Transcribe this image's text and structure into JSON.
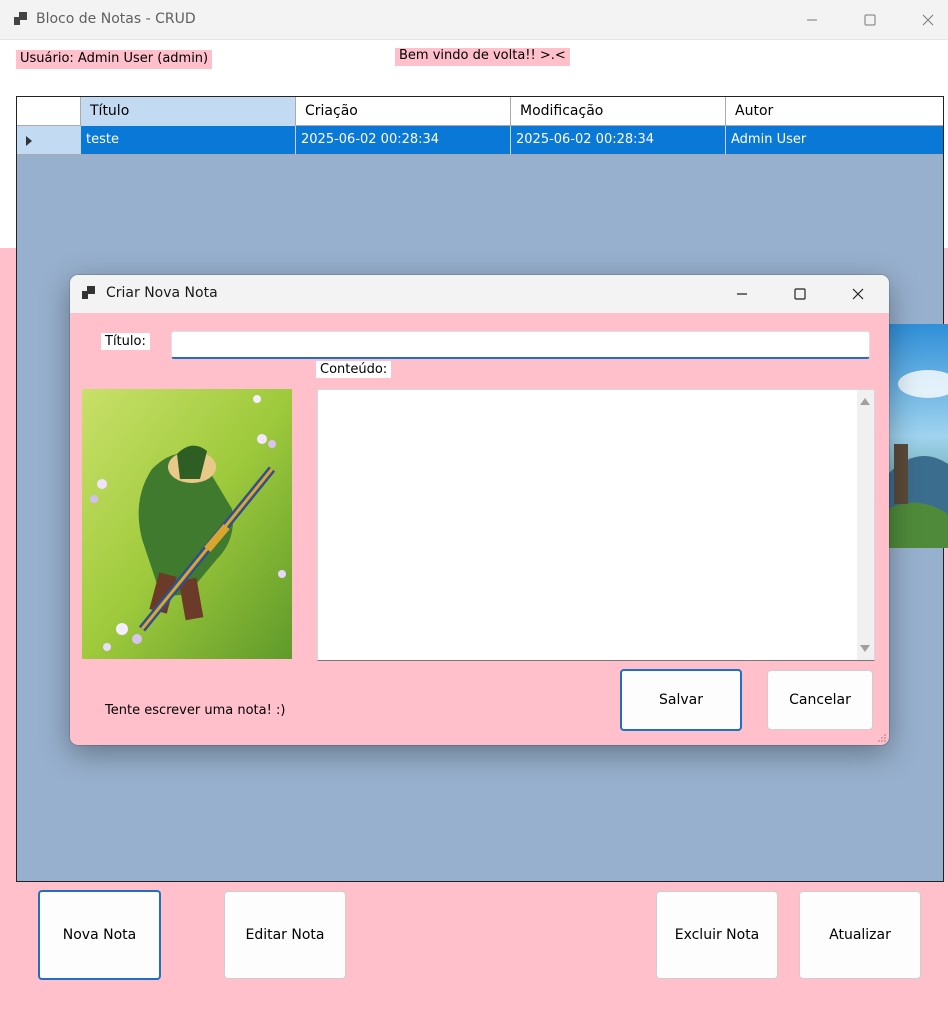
{
  "window": {
    "title": "Bloco de Notas - CRUD"
  },
  "header": {
    "user_label": "Usuário: Admin User (admin)",
    "welcome_label": "Bem vindo de volta!! >.<"
  },
  "grid": {
    "columns": [
      "Título",
      "Criação",
      "Modificação",
      "Autor"
    ],
    "rows": [
      {
        "titulo": "teste",
        "criacao": "2025-06-02 00:28:34",
        "modificacao": "2025-06-02 00:28:34",
        "autor": "Admin User"
      }
    ]
  },
  "buttons": {
    "nova": "Nova Nota",
    "editar": "Editar Nota",
    "excluir": "Excluir Nota",
    "atualizar": "Atualizar"
  },
  "dialog": {
    "title": "Criar Nova Nota",
    "titulo_label": "Título:",
    "titulo_value": "",
    "conteudo_label": "Conteúdo:",
    "conteudo_value": "",
    "hint": "Tente escrever uma nota! :)",
    "salvar": "Salvar",
    "cancelar": "Cancelar"
  },
  "colors": {
    "form_background": "#ffc0cb",
    "grid_background": "#97b0cd",
    "selection": "#0a78d7",
    "accent": "#1f6fc5"
  },
  "icons": {
    "app": "app-window-icon",
    "minimize": "minimize-icon",
    "maximize": "maximize-icon",
    "close": "close-icon"
  }
}
